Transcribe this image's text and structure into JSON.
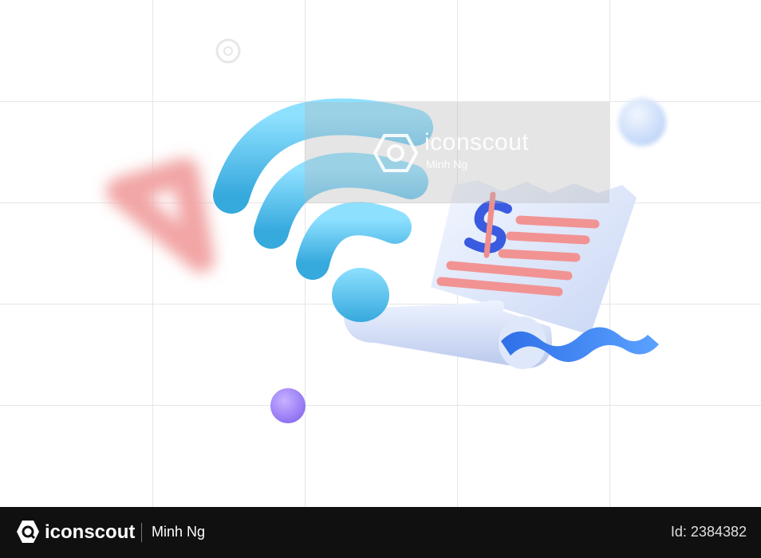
{
  "watermark": {
    "brand": "iconscout",
    "author": "Minh Ng"
  },
  "illustration": {
    "subject": "wifi-bill-payment",
    "colors": {
      "wifi": "#5cc6ec",
      "receipt": "#dbe6fb",
      "lines": "#f08d8d",
      "dollar": "#3a5be0",
      "wave": "#3d7ff0",
      "triangle": "#f3a1a1",
      "sphere_purple": "#a78bfa",
      "sphere_blue": "#d7e6ff"
    }
  },
  "footer": {
    "brand": "iconscout",
    "author": "Minh Ng",
    "id_label": "Id: 2384382"
  }
}
